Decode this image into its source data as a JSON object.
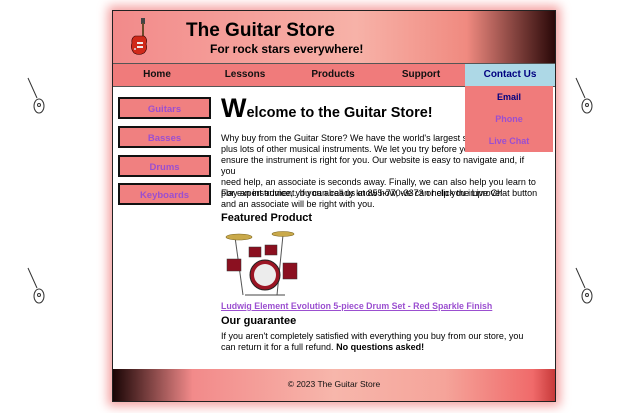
{
  "header": {
    "title": "The Guitar Store",
    "tagline": "For rock stars everywhere!"
  },
  "nav": {
    "items": [
      {
        "label": "Home"
      },
      {
        "label": "Lessons"
      },
      {
        "label": "Products"
      },
      {
        "label": "Support"
      },
      {
        "label": "Contact Us",
        "active": true
      }
    ]
  },
  "contact_dropdown": {
    "items": [
      {
        "label": "Email",
        "color": "#000080"
      },
      {
        "label": "Phone",
        "color": "#9b4fd0"
      },
      {
        "label": "Live Chat",
        "color": "#9b4fd0"
      }
    ]
  },
  "sidebar": {
    "items": [
      {
        "label": "Guitars"
      },
      {
        "label": "Basses"
      },
      {
        "label": "Drums"
      },
      {
        "label": "Keyboards"
      }
    ]
  },
  "main": {
    "welcome_initial": "W",
    "welcome_rest": "elcome to the Guitar Store!",
    "intro_text": "Why buy from the Guitar Store? We have the world's largest se... plus lots of other musical instruments. We let you try before you... ensure the instrument is right for you. Our website is easy to navigate and, if you need help, an associate is seconds away. Finally, we can also help you learn to play an instrument. If you already know how, we can help you improve!",
    "intro_line1": "Why buy from the Guitar Store? We have the world's largest se",
    "intro_line2": "plus lots of other musical instruments. We let you try before you",
    "intro_line3": "ensure the instrument is right for you. Our website is easy to navigate and, if you",
    "intro_line4": "need help, an associate is seconds away. Finally, we can also help you learn to",
    "intro_line5": "play an instrument. If you already know how, we can help you improve!",
    "advice_text": "For expert advice, you can call us at 855-770-3373 or click the Live Chat button and an associate will be right with you.",
    "featured_heading": "Featured Product",
    "product_link": "Ludwig Element Evolution 5-piece Drum Set - Red Sparkle Finish",
    "guarantee_heading": "Our guarantee",
    "guarantee_text": "If you aren't completely satisfied with everything you buy from our store, you can return it for a full refund.",
    "guarantee_emphasis": "No questions asked!"
  },
  "footer": {
    "text": "© 2023 The Guitar Store"
  },
  "colors": {
    "accent": "#f07b7b",
    "link": "#9b4fd0",
    "active_tab": "#add8e6"
  }
}
